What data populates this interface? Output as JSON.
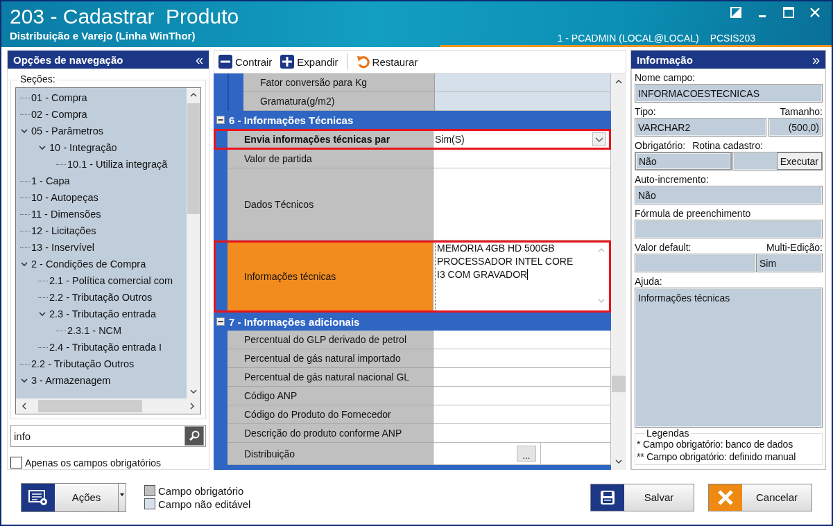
{
  "window": {
    "title": "203 - Cadastrar  Produto",
    "subtitle": "Distribuição e Varejo (Linha WinThor)",
    "user": "1 - PCADMIN (LOCAL@LOCAL)",
    "routine": "PCSIS203"
  },
  "navigation": {
    "title": "Opções de navegação",
    "collapse": "«",
    "sections_label": "Seções:",
    "tree": [
      {
        "label": "01 - Compra"
      },
      {
        "label": "02 - Compra"
      },
      {
        "label": "05 - Parâmetros",
        "expanded": true,
        "children": [
          {
            "label": "10 - Integração",
            "expanded": true,
            "children": [
              {
                "label": "10.1 - Utiliza integraçã"
              }
            ]
          }
        ]
      },
      {
        "label": "1 - Capa"
      },
      {
        "label": "10 - Autopeças"
      },
      {
        "label": "11 - Dimensões"
      },
      {
        "label": "12 - Licitações"
      },
      {
        "label": "13 - Inservível"
      },
      {
        "label": "2 - Condições de Compra",
        "expanded": true,
        "children": [
          {
            "label": "2.1 - Política comercial com"
          },
          {
            "label": "2.2 - Tributação Outros"
          },
          {
            "label": "2.3 - Tributação entrada",
            "expanded": true,
            "children": [
              {
                "label": "2.3.1 - NCM"
              }
            ]
          },
          {
            "label": "2.4 - Tributação entrada I"
          }
        ]
      },
      {
        "label": "2.2 - Tributação Outros"
      },
      {
        "label": "3 - Armazenagem",
        "expanded": true
      }
    ],
    "search": {
      "value": "info"
    },
    "required_only": {
      "label": "Apenas os campos obrigatórios",
      "checked": false
    }
  },
  "toolbar": [
    {
      "label": "Contrair",
      "kind": "collapse"
    },
    {
      "label": "Expandir",
      "kind": "expand"
    },
    {
      "label": "Restaurar",
      "kind": "restore"
    }
  ],
  "grid": {
    "sections": [
      {
        "kind": "subsection",
        "rows": [
          {
            "label": "Fator conversão para Kg",
            "kind": "text",
            "required": false,
            "editable": false,
            "selected": false,
            "highlighted": false
          },
          {
            "label": "Gramatura(g/m2)",
            "kind": "text",
            "required": false,
            "editable": false,
            "selected": false,
            "highlighted": false
          }
        ]
      },
      {
        "kind": "section",
        "title": "6 - Informações Técnicas",
        "expanded": true,
        "rows": [
          {
            "label": "Envia informações técnicas par",
            "kind": "dropdown",
            "value": "Sim(S)",
            "required": true,
            "editable": true,
            "selected": false,
            "highlighted": true
          },
          {
            "label": "Valor de partida",
            "kind": "text",
            "required": false,
            "editable": true,
            "selected": false,
            "highlighted": false
          },
          {
            "label": "Dados Técnicos",
            "kind": "memo",
            "required": false,
            "editable": true,
            "selected": false,
            "highlighted": false
          },
          {
            "label": "Informações técnicas",
            "kind": "memo",
            "value": "MEMORIA 4GB HD 500GB\nPROCESSADOR INTEL CORE\nI3 COM GRAVADOR",
            "required": false,
            "editable": true,
            "selected": true,
            "highlighted": true
          }
        ]
      },
      {
        "kind": "section",
        "title": "7 - Informações adicionais",
        "expanded": true,
        "rows": [
          {
            "label": "Percentual do GLP derivado de petrol",
            "kind": "text",
            "required": false,
            "editable": true,
            "selected": false,
            "highlighted": false
          },
          {
            "label": "Percentual de gás natural importado",
            "kind": "text",
            "required": false,
            "editable": true,
            "selected": false,
            "highlighted": false
          },
          {
            "label": "Percentual de gás natural nacional GL",
            "kind": "text",
            "required": false,
            "editable": true,
            "selected": false,
            "highlighted": false
          },
          {
            "label": "Código ANP",
            "kind": "text",
            "required": false,
            "editable": true,
            "selected": false,
            "highlighted": false
          },
          {
            "label": "Código do Produto do Fornecedor",
            "kind": "text",
            "required": false,
            "editable": true,
            "selected": false,
            "highlighted": false
          },
          {
            "label": "Descrição do produto conforme ANP",
            "kind": "text",
            "required": false,
            "editable": true,
            "selected": false,
            "highlighted": false
          },
          {
            "label": "Distribuição",
            "kind": "lookup",
            "button": "...",
            "required": false,
            "editable": true,
            "selected": false,
            "highlighted": false
          }
        ]
      }
    ]
  },
  "info": {
    "title": "Informação",
    "expand": "»",
    "field_name": {
      "label": "Nome campo:",
      "value": "INFORMACOESTECNICAS"
    },
    "type": {
      "label": "Tipo:",
      "value": "VARCHAR2"
    },
    "size": {
      "label": "Tamanho:",
      "value": "(500,0)"
    },
    "required": {
      "label": "Obrigatório:",
      "value": "Não"
    },
    "routine": {
      "label": "Rotina cadastro:",
      "button": "Executar"
    },
    "auto_increment": {
      "label": "Auto-incremento:",
      "value": "Não"
    },
    "formula": {
      "label": "Fórmula de preenchimento"
    },
    "default": {
      "label": "Valor default:"
    },
    "multi_edit": {
      "label": "Multi-Edição:",
      "value": "Sim"
    },
    "help": {
      "label": "Ajuda:",
      "value": "Informações técnicas"
    },
    "legend": {
      "title": "Legendas",
      "items": [
        "* Campo obrigatório: banco de dados",
        "** Campo obrigatório: definido manual"
      ]
    }
  },
  "footer": {
    "actions": "Ações",
    "legend": [
      {
        "label": "Campo obrigatório",
        "color": "#c0c0c0"
      },
      {
        "label": "Campo não editável",
        "color": "#d6e0ea"
      }
    ],
    "save": "Salvar",
    "cancel": "Cancelar"
  }
}
